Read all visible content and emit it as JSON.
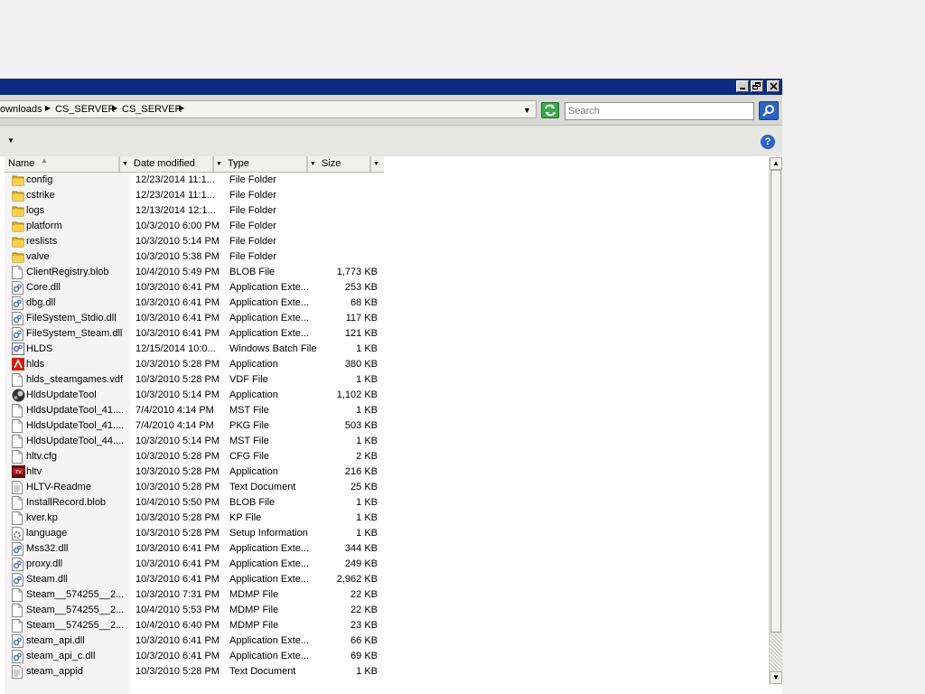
{
  "window": {
    "controls": [
      "minimize",
      "maximize",
      "close"
    ]
  },
  "address": {
    "crumbs": [
      "ownloads",
      "CS_SERVER",
      "CS_SERVER"
    ],
    "search_placeholder": "Search"
  },
  "toolbar": {
    "help_label": "?"
  },
  "columns": [
    "Name",
    "Date modified",
    "Type",
    "Size"
  ],
  "files": [
    {
      "name": "config",
      "date": "12/23/2014 11:1...",
      "type": "File Folder",
      "size": "",
      "icon": "folder"
    },
    {
      "name": "cstrike",
      "date": "12/23/2014 11:1...",
      "type": "File Folder",
      "size": "",
      "icon": "folder"
    },
    {
      "name": "logs",
      "date": "12/13/2014 12:1...",
      "type": "File Folder",
      "size": "",
      "icon": "folder"
    },
    {
      "name": "platform",
      "date": "10/3/2010 6:00 PM",
      "type": "File Folder",
      "size": "",
      "icon": "folder"
    },
    {
      "name": "reslists",
      "date": "10/3/2010 5:14 PM",
      "type": "File Folder",
      "size": "",
      "icon": "folder"
    },
    {
      "name": "valve",
      "date": "10/3/2010 5:38 PM",
      "type": "File Folder",
      "size": "",
      "icon": "folder"
    },
    {
      "name": "ClientRegistry.blob",
      "date": "10/4/2010 5:49 PM",
      "type": "BLOB File",
      "size": "1,773 KB",
      "icon": "file"
    },
    {
      "name": "Core.dll",
      "date": "10/3/2010 6:41 PM",
      "type": "Application Exte...",
      "size": "253 KB",
      "icon": "dll"
    },
    {
      "name": "dbg.dll",
      "date": "10/3/2010 6:41 PM",
      "type": "Application Exte...",
      "size": "68 KB",
      "icon": "dll"
    },
    {
      "name": "FileSystem_Stdio.dll",
      "date": "10/3/2010 6:41 PM",
      "type": "Application Exte...",
      "size": "117 KB",
      "icon": "dll"
    },
    {
      "name": "FileSystem_Steam.dll",
      "date": "10/3/2010 6:41 PM",
      "type": "Application Exte...",
      "size": "121 KB",
      "icon": "dll"
    },
    {
      "name": "HLDS",
      "date": "12/15/2014 10:0...",
      "type": "Windows Batch File",
      "size": "1 KB",
      "icon": "batch"
    },
    {
      "name": "hlds",
      "date": "10/3/2010 5:28 PM",
      "type": "Application",
      "size": "380 KB",
      "icon": "hlds"
    },
    {
      "name": "hlds_steamgames.vdf",
      "date": "10/3/2010 5:28 PM",
      "type": "VDF File",
      "size": "1 KB",
      "icon": "file"
    },
    {
      "name": "HldsUpdateTool",
      "date": "10/3/2010 5:14 PM",
      "type": "Application",
      "size": "1,102 KB",
      "icon": "steam"
    },
    {
      "name": "HldsUpdateTool_41....",
      "date": "7/4/2010 4:14 PM",
      "type": "MST File",
      "size": "1 KB",
      "icon": "file"
    },
    {
      "name": "HldsUpdateTool_41....",
      "date": "7/4/2010 4:14 PM",
      "type": "PKG File",
      "size": "503 KB",
      "icon": "file"
    },
    {
      "name": "HldsUpdateTool_44....",
      "date": "10/3/2010 5:14 PM",
      "type": "MST File",
      "size": "1 KB",
      "icon": "file"
    },
    {
      "name": "hltv.cfg",
      "date": "10/3/2010 5:28 PM",
      "type": "CFG File",
      "size": "2 KB",
      "icon": "file"
    },
    {
      "name": "hltv",
      "date": "10/3/2010 5:28 PM",
      "type": "Application",
      "size": "216 KB",
      "icon": "hltv"
    },
    {
      "name": "HLTV-Readme",
      "date": "10/3/2010 5:28 PM",
      "type": "Text Document",
      "size": "25 KB",
      "icon": "text"
    },
    {
      "name": "InstallRecord.blob",
      "date": "10/4/2010 5:50 PM",
      "type": "BLOB File",
      "size": "1 KB",
      "icon": "file"
    },
    {
      "name": "kver.kp",
      "date": "10/3/2010 5:28 PM",
      "type": "KP File",
      "size": "1 KB",
      "icon": "file"
    },
    {
      "name": "language",
      "date": "10/3/2010 5:28 PM",
      "type": "Setup Information",
      "size": "1 KB",
      "icon": "setup"
    },
    {
      "name": "Mss32.dll",
      "date": "10/3/2010 6:41 PM",
      "type": "Application Exte...",
      "size": "344 KB",
      "icon": "dll"
    },
    {
      "name": "proxy.dll",
      "date": "10/3/2010 6:41 PM",
      "type": "Application Exte...",
      "size": "249 KB",
      "icon": "dll"
    },
    {
      "name": "Steam.dll",
      "date": "10/3/2010 6:41 PM",
      "type": "Application Exte...",
      "size": "2,962 KB",
      "icon": "dll"
    },
    {
      "name": "Steam__574255__2...",
      "date": "10/3/2010 7:31 PM",
      "type": "MDMP File",
      "size": "22 KB",
      "icon": "file"
    },
    {
      "name": "Steam__574255__2...",
      "date": "10/4/2010 5:53 PM",
      "type": "MDMP File",
      "size": "22 KB",
      "icon": "file"
    },
    {
      "name": "Steam__574255__2...",
      "date": "10/4/2010 6:40 PM",
      "type": "MDMP File",
      "size": "23 KB",
      "icon": "file"
    },
    {
      "name": "steam_api.dll",
      "date": "10/3/2010 6:41 PM",
      "type": "Application Exte...",
      "size": "66 KB",
      "icon": "dll"
    },
    {
      "name": "steam_api_c.dll",
      "date": "10/3/2010 6:41 PM",
      "type": "Application Exte...",
      "size": "69 KB",
      "icon": "dll"
    },
    {
      "name": "steam_appid",
      "date": "10/3/2010 5:28 PM",
      "type": "Text Document",
      "size": "1 KB",
      "icon": "text"
    }
  ]
}
